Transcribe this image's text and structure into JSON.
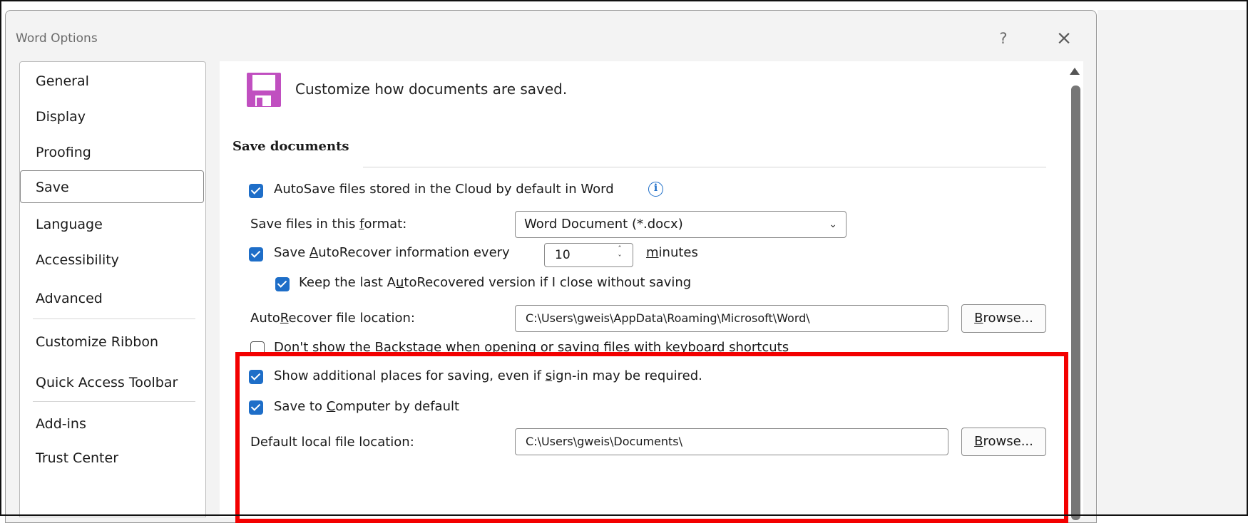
{
  "window": {
    "title": "Word Options",
    "help_label": "?",
    "close_label": "×"
  },
  "sidebar": {
    "items": [
      {
        "label": "General"
      },
      {
        "label": "Display"
      },
      {
        "label": "Proofing"
      },
      {
        "label": "Save",
        "selected": true
      },
      {
        "label": "Language"
      },
      {
        "label": "Accessibility"
      },
      {
        "label": "Advanced"
      },
      {
        "label": "Customize Ribbon"
      },
      {
        "label": "Quick Access Toolbar"
      },
      {
        "label": "Add-ins"
      },
      {
        "label": "Trust Center"
      }
    ]
  },
  "header": {
    "icon": "save-disk-icon",
    "text": "Customize how documents are saved."
  },
  "section": {
    "title": "Save documents"
  },
  "options": {
    "autosave": {
      "label": "AutoSave files stored in the Cloud by default in Word",
      "checked": true
    },
    "format": {
      "label_pre": "Save files in this ",
      "label_u": "f",
      "label_post": "ormat:",
      "value": "Word Document (*.docx)"
    },
    "autorecover": {
      "label_pre": "Save ",
      "label_u": "A",
      "label_post": "utoRecover information every",
      "checked": true,
      "minutes_value": "10",
      "minutes_u": "m",
      "minutes_post": "inutes"
    },
    "keep_last": {
      "label_pre": "Keep the last A",
      "label_u": "u",
      "label_post": "toRecovered version if I close without saving",
      "checked": true
    },
    "ar_location": {
      "label_pre": "Auto",
      "label_u": "R",
      "label_post": "ecover file location:",
      "value": "C:\\Users\\gweis\\AppData\\Roaming\\Microsoft\\Word\\",
      "browse_u": "B",
      "browse_post": "rowse..."
    },
    "backstage": {
      "label": "Don't show the Backstage when opening or saving files with keyboard shortcuts",
      "checked": false
    },
    "additional_places": {
      "label_pre": "Show additional places for saving, even if ",
      "label_u": "s",
      "label_post": "ign-in may be required.",
      "checked": true
    },
    "save_computer": {
      "label_pre": "Save to ",
      "label_u": "C",
      "label_post": "omputer by default",
      "checked": true
    },
    "local_location": {
      "label_pre": "Default local f",
      "label_u": "i",
      "label_post": "le location:",
      "value": "C:\\Users\\gweis\\Documents\\",
      "browse_u": "B",
      "browse_post": "rowse..."
    }
  },
  "colors": {
    "accent": "#1e6ec8",
    "highlight": "#f30000",
    "icon_purple": "#c04fc0"
  }
}
